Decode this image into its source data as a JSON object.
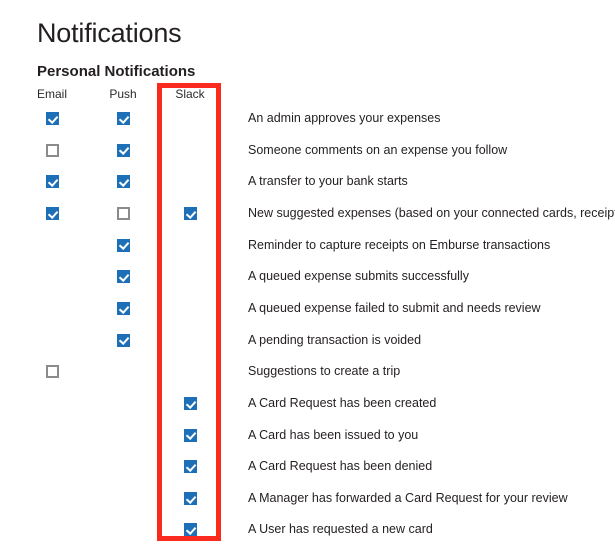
{
  "page": {
    "title": "Notifications",
    "section_title": "Personal Notifications"
  },
  "colors": {
    "checkbox_checked": "#1d70b7",
    "checkbox_border": "#8b8b8b",
    "highlight_box": "#fa2a1e",
    "text": "#231f20",
    "background": "#ffffff"
  },
  "columns": [
    {
      "key": "email",
      "label": "Email"
    },
    {
      "key": "push",
      "label": "Push"
    },
    {
      "key": "slack",
      "label": "Slack"
    }
  ],
  "highlight": {
    "target_column": "slack",
    "color": "#fa2a1e"
  },
  "rows": [
    {
      "label": "An admin approves your expenses",
      "email": "checked",
      "push": "checked",
      "slack": "none"
    },
    {
      "label": "Someone comments on an expense you follow",
      "email": "unchecked",
      "push": "checked",
      "slack": "none"
    },
    {
      "label": "A transfer to your bank starts",
      "email": "checked",
      "push": "checked",
      "slack": "none"
    },
    {
      "label": "New suggested expenses (based on your connected cards, receipts, etc.)",
      "email": "checked",
      "push": "unchecked",
      "slack": "checked"
    },
    {
      "label": "Reminder to capture receipts on Emburse transactions",
      "email": "none",
      "push": "checked",
      "slack": "none"
    },
    {
      "label": "A queued expense submits successfully",
      "email": "none",
      "push": "checked",
      "slack": "none"
    },
    {
      "label": "A queued expense failed to submit and needs review",
      "email": "none",
      "push": "checked",
      "slack": "none"
    },
    {
      "label": "A pending transaction is voided",
      "email": "none",
      "push": "checked",
      "slack": "none"
    },
    {
      "label": "Suggestions to create a trip",
      "email": "unchecked",
      "push": "none",
      "slack": "none"
    },
    {
      "label": "A Card Request has been created",
      "email": "none",
      "push": "none",
      "slack": "checked"
    },
    {
      "label": "A Card has been issued to you",
      "email": "none",
      "push": "none",
      "slack": "checked"
    },
    {
      "label": "A Card Request has been denied",
      "email": "none",
      "push": "none",
      "slack": "checked"
    },
    {
      "label": "A Manager has forwarded a Card Request for your review",
      "email": "none",
      "push": "none",
      "slack": "checked"
    },
    {
      "label": "A User has requested a new card",
      "email": "none",
      "push": "none",
      "slack": "checked"
    }
  ]
}
